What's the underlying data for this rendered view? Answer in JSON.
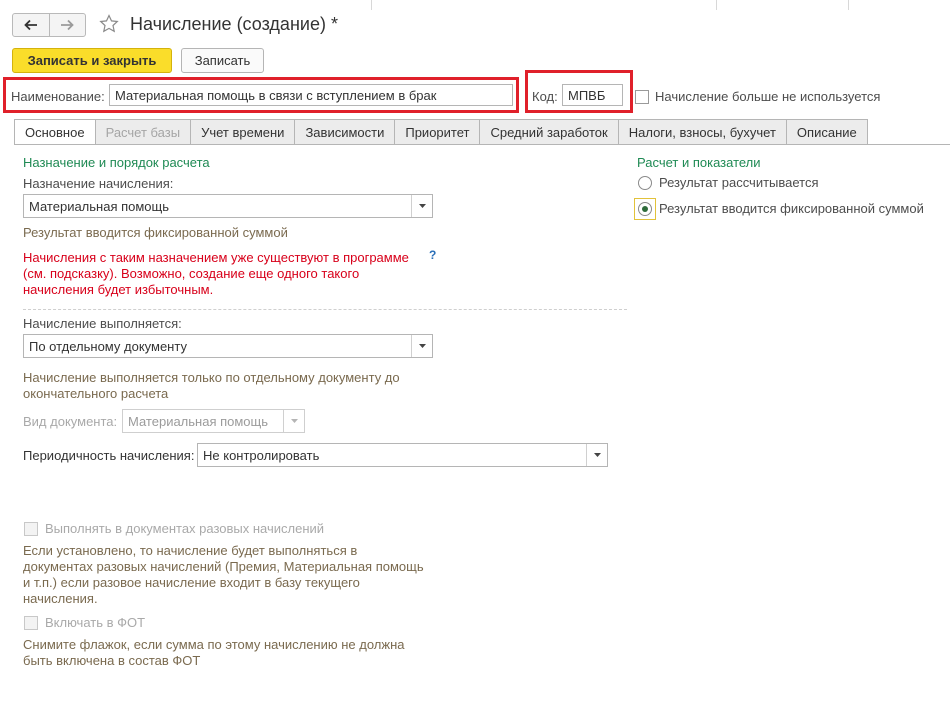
{
  "header": {
    "title": "Начисление (создание) *",
    "back_icon": "arrow-left-icon",
    "forward_icon": "arrow-right-icon",
    "favorite_icon": "star-icon"
  },
  "toolbar": {
    "save_close_label": "Записать и закрыть",
    "save_label": "Записать"
  },
  "form": {
    "name_label": "Наименование:",
    "name_value": "Материальная помощь в связи с вступлением в брак",
    "code_label": "Код:",
    "code_value": "МПВБ",
    "not_used_label": "Начисление больше не используется"
  },
  "tabs": [
    {
      "label": "Основное",
      "active": true
    },
    {
      "label": "Расчет базы",
      "disabled": true
    },
    {
      "label": "Учет времени"
    },
    {
      "label": "Зависимости"
    },
    {
      "label": "Приоритет"
    },
    {
      "label": "Средний заработок"
    },
    {
      "label": "Налоги, взносы, бухучет"
    },
    {
      "label": "Описание"
    }
  ],
  "main": {
    "section_title": "Назначение и порядок расчета",
    "purpose_label": "Назначение начисления:",
    "purpose_value": "Материальная помощь",
    "purpose_note": "Результат вводится фиксированной суммой",
    "warning_line1": "Начисления с таким назначением уже существуют в программе",
    "warning_line2": "(см. подсказку). Возможно, создание еще одного такого",
    "warning_line3": "начисления будет избыточным.",
    "help_mark": "?",
    "execution_label": "Начисление выполняется:",
    "execution_value": "По отдельному документу",
    "execution_note_line1": "Начисление выполняется только по отдельному документу до",
    "execution_note_line2": "окончательного расчета",
    "doc_type_label": "Вид документа:",
    "doc_type_value": "Материальная помощь",
    "periodicity_label": "Периодичность начисления:",
    "periodicity_value": "Не контролировать",
    "one_time_label": "Выполнять в документах разовых начислений",
    "one_time_note_line1": "Если установлено, то начисление будет выполняться в",
    "one_time_note_line2": "документах разовых начислений (Премия, Материальная помощь",
    "one_time_note_line3": "и т.п.) если разовое начисление входит в базу текущего",
    "one_time_note_line4": "начисления.",
    "fot_label": "Включать в ФОТ",
    "fot_note_line1": "Снимите флажок, если сумма по этому начислению не должна",
    "fot_note_line2": "быть включена в состав ФОТ"
  },
  "right": {
    "section_title": "Расчет и показатели",
    "option_calculated": "Результат рассчитывается",
    "option_fixed": "Результат вводится фиксированной суммой",
    "selected": "option_fixed"
  },
  "colors": {
    "primary_button": "#fadd2a",
    "section_title": "#1f8a54",
    "warning": "#d8001a",
    "highlight_frame": "#e0202a"
  }
}
